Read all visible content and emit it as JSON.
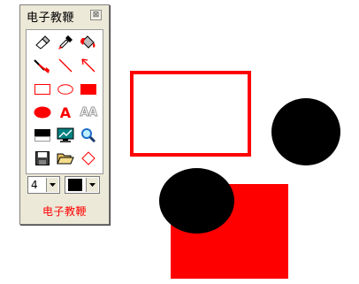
{
  "panel": {
    "title": "电子教鞭",
    "close_label": "⊠",
    "footer_text": "电子教鞭",
    "pen_size": "4",
    "current_color": "#000000",
    "accent_color": "#ff0000",
    "tools": [
      {
        "name": "eraser-icon"
      },
      {
        "name": "pen-icon"
      },
      {
        "name": "fill-icon"
      },
      {
        "name": "highlighter-icon"
      },
      {
        "name": "line-icon"
      },
      {
        "name": "arrow-icon"
      },
      {
        "name": "rectangle-icon"
      },
      {
        "name": "ellipse-icon"
      },
      {
        "name": "filled-rectangle-icon"
      },
      {
        "name": "filled-ellipse-icon"
      },
      {
        "name": "text-bold-icon",
        "glyph": "A"
      },
      {
        "name": "text-outline-icon",
        "glyph": "AA"
      },
      {
        "name": "black-white-icon"
      },
      {
        "name": "screen-capture-icon"
      },
      {
        "name": "magnifier-icon"
      },
      {
        "name": "save-icon"
      },
      {
        "name": "open-folder-icon"
      },
      {
        "name": "diamond-icon"
      }
    ]
  },
  "canvas": {
    "colors": {
      "red": "#ff0000",
      "black": "#000000"
    },
    "shapes": [
      "outline-rectangle",
      "black-circle",
      "red-square",
      "black-ellipse"
    ]
  }
}
